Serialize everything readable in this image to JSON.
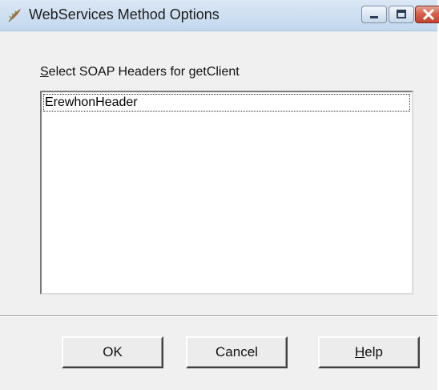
{
  "window": {
    "title": "WebServices Method Options",
    "icon": "feather-app-icon"
  },
  "caption_buttons": {
    "minimize": "minimize-icon",
    "maximize": "maximize-icon",
    "close": "close-icon"
  },
  "headers_list": {
    "label_prefix": "",
    "label_mnemonic": "S",
    "label_rest": "elect SOAP Headers for getClient",
    "items": [
      "ErewhonHeader"
    ]
  },
  "buttons": {
    "ok": "OK",
    "cancel": "Cancel",
    "help_mnemonic": "H",
    "help_rest": "elp"
  },
  "colors": {
    "titlebar": "#cfe0f2",
    "dialog_bg": "#f0f0f0",
    "close_button": "#d7604c"
  }
}
